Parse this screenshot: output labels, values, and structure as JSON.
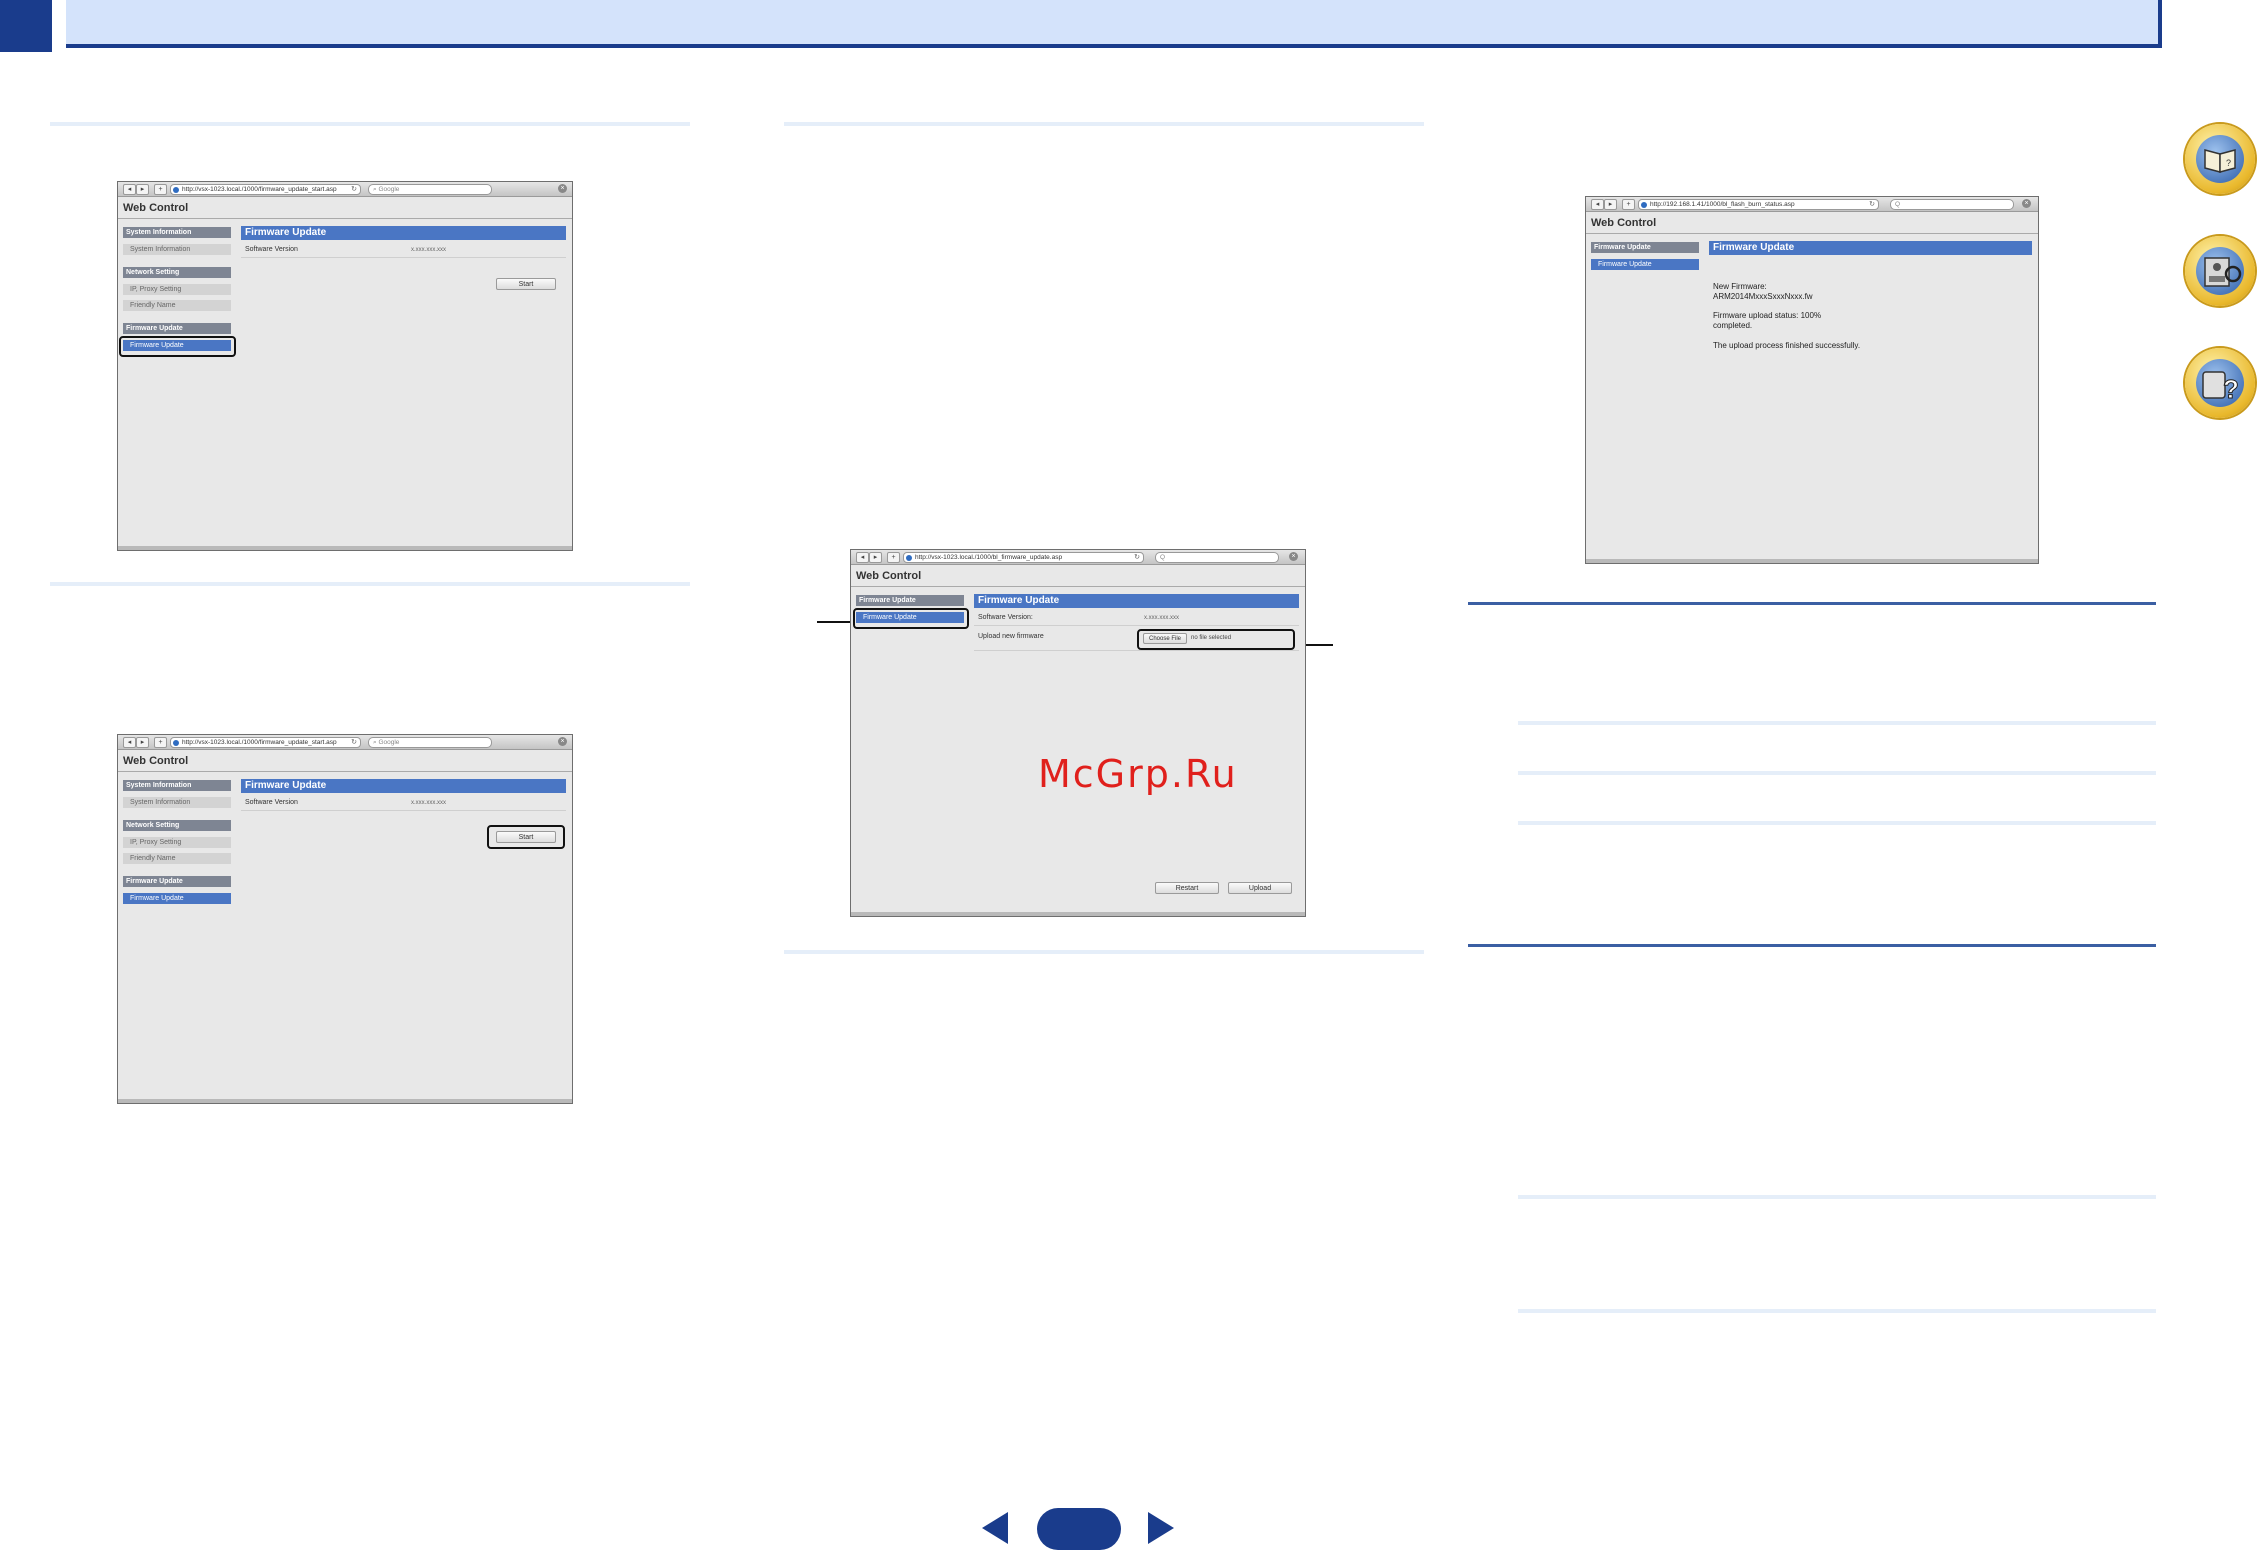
{
  "shot1": {
    "url": "http://vsx-1023.local./1000/firmware_update_start.asp",
    "search": "Google",
    "title": "Web Control",
    "sidebar": {
      "head1": "System Information",
      "item1": "System Information",
      "head2": "Network Setting",
      "item2": "IP, Proxy Setting",
      "item3": "Friendly Name",
      "head3": "Firmware Update",
      "item4": "Firmware Update"
    },
    "main_head": "Firmware Update",
    "label": "Software Version",
    "value": "x.xxx.xxx.xxx",
    "button": "Start"
  },
  "shot2": {
    "url": "http://vsx-1023.local./1000/firmware_update_start.asp",
    "search": "Google",
    "title": "Web Control",
    "sidebar": {
      "head1": "System Information",
      "item1": "System Information",
      "head2": "Network Setting",
      "item2": "IP, Proxy Setting",
      "item3": "Friendly Name",
      "head3": "Firmware Update",
      "item4": "Firmware Update"
    },
    "main_head": "Firmware Update",
    "label": "Software Version",
    "value": "x.xxx.xxx.xxx",
    "button": "Start"
  },
  "shot3": {
    "url": "http://vsx-1023.local./1000/bl_firmware_update.asp",
    "search": "Q",
    "title": "Web Control",
    "sidebar": {
      "head1": "Firmware Update",
      "item1": "Firmware Update"
    },
    "main_head": "Firmware Update",
    "label1": "Software Version:",
    "value1": "x.xxx.xxx.xxx",
    "label2": "Upload new firmware",
    "choose": "Choose File",
    "no_file": "no file selected",
    "restart": "Restart",
    "upload": "Upload"
  },
  "shot4": {
    "url": "http://192.168.1.41/1000/bl_flash_burn_status.asp",
    "search": "Q",
    "title": "Web Control",
    "sidebar": {
      "head1": "Firmware Update",
      "item1": "Firmware Update"
    },
    "main_head": "Firmware Update",
    "line1": "New Firmware:",
    "line2": "ARM2014MxxxSxxxNxxx.fw",
    "line3": "Firmware upload status: 100%",
    "line4": "completed.",
    "line5": "The upload process finished successfully."
  },
  "watermark": "McGrp.Ru",
  "icons": [
    "manual-book-icon",
    "receiver-icon",
    "remote-help-icon"
  ],
  "colors": {
    "accent": "#1a3c8c",
    "band": "#d4e3fb",
    "highlight": "#4a76c4"
  }
}
